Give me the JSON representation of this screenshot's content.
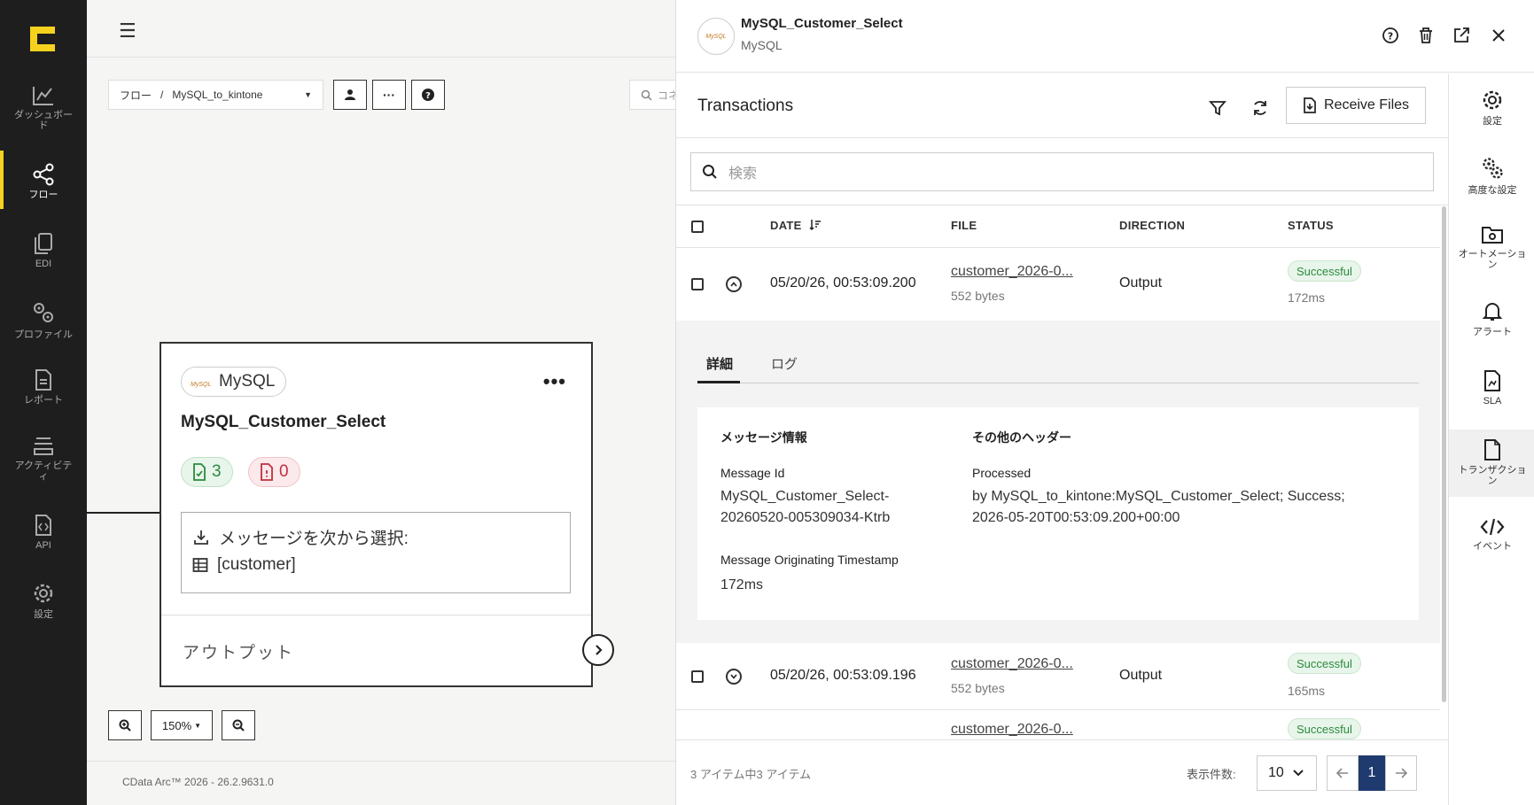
{
  "nav": {
    "items": [
      {
        "label": "ダッシュボード",
        "icon": "chart-line-icon"
      },
      {
        "label": "フロー",
        "icon": "share-nodes-icon"
      },
      {
        "label": "EDI",
        "icon": "files-icon"
      },
      {
        "label": "プロファイル",
        "icon": "gears-icon"
      },
      {
        "label": "レポート",
        "icon": "document-icon"
      },
      {
        "label": "アクティビティ",
        "icon": "layers-icon"
      },
      {
        "label": "API",
        "icon": "api-file-icon"
      },
      {
        "label": "設定",
        "icon": "gear-icon"
      }
    ],
    "active": "フロー"
  },
  "canvas": {
    "breadcrumb_root": "フロー",
    "breadcrumb_sep": "/",
    "breadcrumb_flow": "MySQL_to_kintone",
    "search_placeholder": "コネ",
    "zoom": "150%",
    "footer": "CData Arc™ 2026 - 26.2.9631.0"
  },
  "connector_card": {
    "type": "MySQL",
    "name": "MySQL_Customer_Select",
    "success_count": "3",
    "error_count": "0",
    "select_label": "メッセージを次から選択:",
    "table": "[customer]",
    "output_label": "アウトプット"
  },
  "panel": {
    "title": "MySQL_Customer_Select",
    "subtitle": "MySQL",
    "logo_text": "MySQL"
  },
  "transactions": {
    "title": "Transactions",
    "receive_button": "Receive Files",
    "search_placeholder": "検索",
    "columns": {
      "date": "DATE",
      "file": "FILE",
      "direction": "DIRECTION",
      "status": "STATUS"
    },
    "rows": [
      {
        "date": "05/20/26, 00:53:09.200",
        "file": "customer_2026-0...",
        "size": "552 bytes",
        "direction": "Output",
        "status": "Successful",
        "duration": "172ms"
      },
      {
        "date": "05/20/26, 00:53:09.196",
        "file": "customer_2026-0...",
        "size": "552 bytes",
        "direction": "Output",
        "status": "Successful",
        "duration": "165ms"
      },
      {
        "date": "",
        "file": "customer_2026-0...",
        "size": "",
        "direction": "",
        "status": "Successful",
        "duration": ""
      }
    ],
    "detail": {
      "tab_details": "詳細",
      "tab_log": "ログ",
      "message_info_heading": "メッセージ情報",
      "other_headers_heading": "その他のヘッダー",
      "message_id_label": "Message Id",
      "message_id_line1": "MySQL_Customer_Select-",
      "message_id_line2": "20260520-005309034-Ktrb",
      "processed_label": "Processed",
      "processed_line1": "by MySQL_to_kintone:MySQL_Customer_Select; Success;",
      "processed_line2": "2026-05-20T00:53:09.200+00:00",
      "timestamp_label": "Message Originating Timestamp",
      "timestamp_value": "172ms"
    },
    "footer": {
      "count": "3 アイテム中3 アイテム",
      "per_page_label": "表示件数:",
      "per_page": "10",
      "page": "1"
    }
  },
  "right_bar": {
    "items": [
      {
        "label": "設定",
        "icon": "gear-icon"
      },
      {
        "label": "高度な設定",
        "icon": "gears-icon"
      },
      {
        "label": "オートメーション",
        "icon": "folder-gear-icon"
      },
      {
        "label": "アラート",
        "icon": "bell-icon"
      },
      {
        "label": "SLA",
        "icon": "sla-file-icon"
      },
      {
        "label": "トランザクション",
        "icon": "file-icon"
      },
      {
        "label": "イベント",
        "icon": "code-icon"
      }
    ],
    "active": "トランザクション"
  }
}
